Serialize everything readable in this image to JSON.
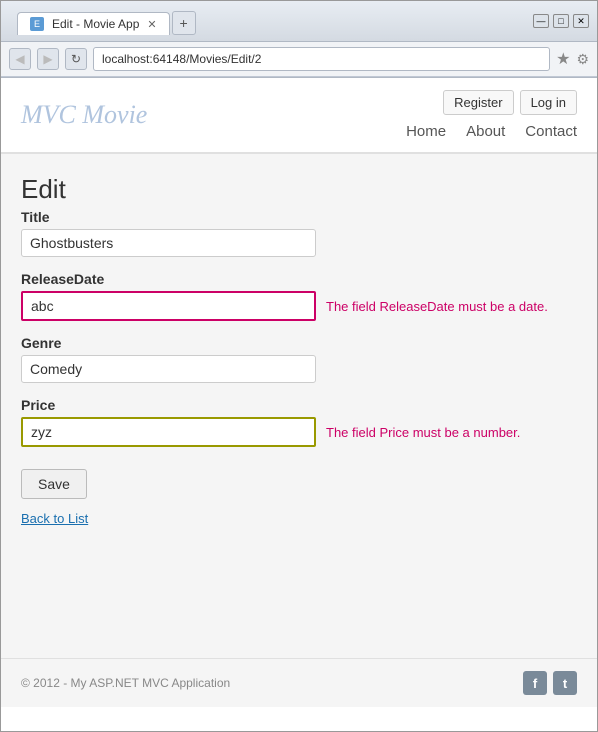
{
  "browser": {
    "tab_label": "Edit - Movie App",
    "tab_icon": "E",
    "url": "localhost:64148/Movies/Edit/2",
    "new_tab_icon": "+",
    "back_icon": "◀",
    "forward_icon": "▶",
    "refresh_icon": "↻",
    "star_icon": "★",
    "settings_icon": "⚙",
    "win_minimize": "—",
    "win_maximize": "□",
    "win_close": "✕"
  },
  "auth": {
    "register_label": "Register",
    "login_label": "Log in"
  },
  "nav": {
    "home_label": "Home",
    "about_label": "About",
    "contact_label": "Contact"
  },
  "site": {
    "title": "MVC Movie"
  },
  "form": {
    "heading": "Edit",
    "title_label": "Title",
    "title_value": "Ghostbusters",
    "release_label": "ReleaseDate",
    "release_value": "abc",
    "release_error": "The field ReleaseDate must be a date.",
    "genre_label": "Genre",
    "genre_value": "Comedy",
    "price_label": "Price",
    "price_value": "zyz",
    "price_error": "The field Price must be a number.",
    "save_label": "Save",
    "back_label": "Back to List"
  },
  "footer": {
    "copyright": "© 2012 - My ASP.NET MVC Application",
    "facebook": "f",
    "twitter": "t"
  }
}
